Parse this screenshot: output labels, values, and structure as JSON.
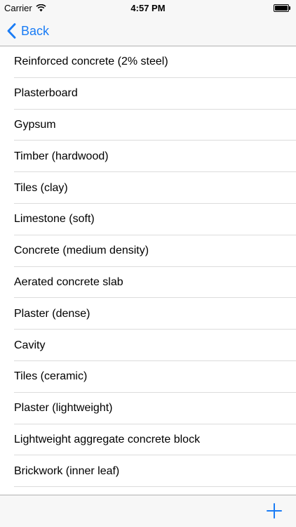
{
  "status_bar": {
    "carrier": "Carrier",
    "time": "4:57 PM",
    "wifi_icon": "wifi-icon",
    "battery_icon": "battery-icon"
  },
  "nav": {
    "back_label": "Back",
    "back_icon": "chevron-left-icon"
  },
  "materials": [
    "Reinforced concrete (2% steel)",
    "Plasterboard",
    "Gypsum",
    "Timber (hardwood)",
    "Tiles (clay)",
    "Limestone (soft)",
    "Concrete (medium density)",
    "Aerated concrete slab",
    "Plaster (dense)",
    "Cavity",
    "Tiles (ceramic)",
    "Plaster (lightweight)",
    "Lightweight aggregate concrete block",
    "Brickwork (inner leaf)"
  ],
  "toolbar": {
    "add_icon": "plus-icon"
  },
  "colors": {
    "accent": "#1a7cf5",
    "bar_background": "#f7f7f7",
    "separator": "#dcdcdc"
  }
}
